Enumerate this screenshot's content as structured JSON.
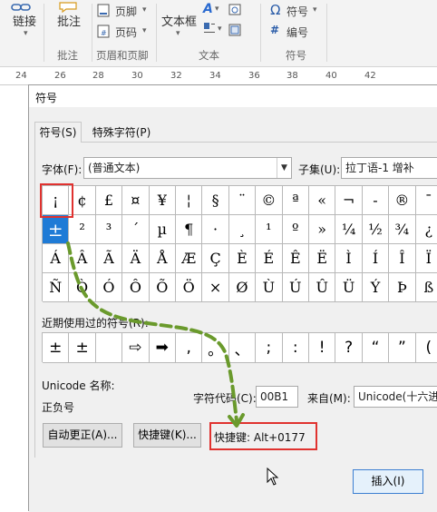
{
  "ribbon": {
    "link": "链接",
    "comment": "批注",
    "header": "页脚",
    "page_number": "页码",
    "textbox": "文本框",
    "symbol": "符号",
    "number": "编号",
    "groups": [
      "批注",
      "页眉和页脚",
      "文本",
      "符号"
    ]
  },
  "ruler": [
    "24",
    "26",
    "28",
    "30",
    "32",
    "34",
    "36",
    "38",
    "40",
    "42"
  ],
  "dialog": {
    "title": "符号",
    "tabs": [
      "符号(S)",
      "特殊字符(P)"
    ],
    "font_label": "字体(F):",
    "font_value": "(普通文本)",
    "subset_label": "子集(U):",
    "subset_value": "拉丁语-1 增补",
    "symbol_rows": [
      [
        "¡",
        "¢",
        "£",
        "¤",
        "¥",
        "¦",
        "§",
        "¨",
        "©",
        "ª",
        "«",
        "¬",
        "-",
        "®",
        "¯"
      ],
      [
        "±",
        "²",
        "³",
        "´",
        "µ",
        "¶",
        "·",
        "¸",
        "¹",
        "º",
        "»",
        "¼",
        "½",
        "¾",
        "¿"
      ],
      [
        "Á",
        "Â",
        "Ã",
        "Ä",
        "Å",
        "Æ",
        "Ç",
        "È",
        "É",
        "Ê",
        "Ë",
        "Ì",
        "Í",
        "Î",
        "Ï"
      ],
      [
        "Ñ",
        "Ò",
        "Ó",
        "Ô",
        "Õ",
        "Ö",
        "×",
        "Ø",
        "Ù",
        "Ú",
        "Û",
        "Ü",
        "Ý",
        "Þ",
        "ß"
      ]
    ],
    "selected_symbol": "±",
    "recent_label": "近期使用过的符号(R):",
    "recent_symbols": [
      "±",
      "±",
      "",
      "⇨",
      "➡",
      ",",
      "。",
      "、",
      ";",
      ":",
      "!",
      "?",
      "“",
      "”",
      "("
    ],
    "unicode_name_label": "Unicode 名称:",
    "unicode_name_value": "正负号",
    "char_code_label": "字符代码(C):",
    "char_code_value": "00B1",
    "from_label": "来自(M):",
    "from_value": "Unicode(十六进",
    "autocorrect_button": "自动更正(A)...",
    "shortcut_button": "快捷键(K)...",
    "shortcut_text": "快捷键: Alt+0177",
    "insert_button": "插入(I)",
    "highlight_color": "#e0322f",
    "arrow_color": "#6a9a2c",
    "selection_color": "#1f7bd6"
  }
}
